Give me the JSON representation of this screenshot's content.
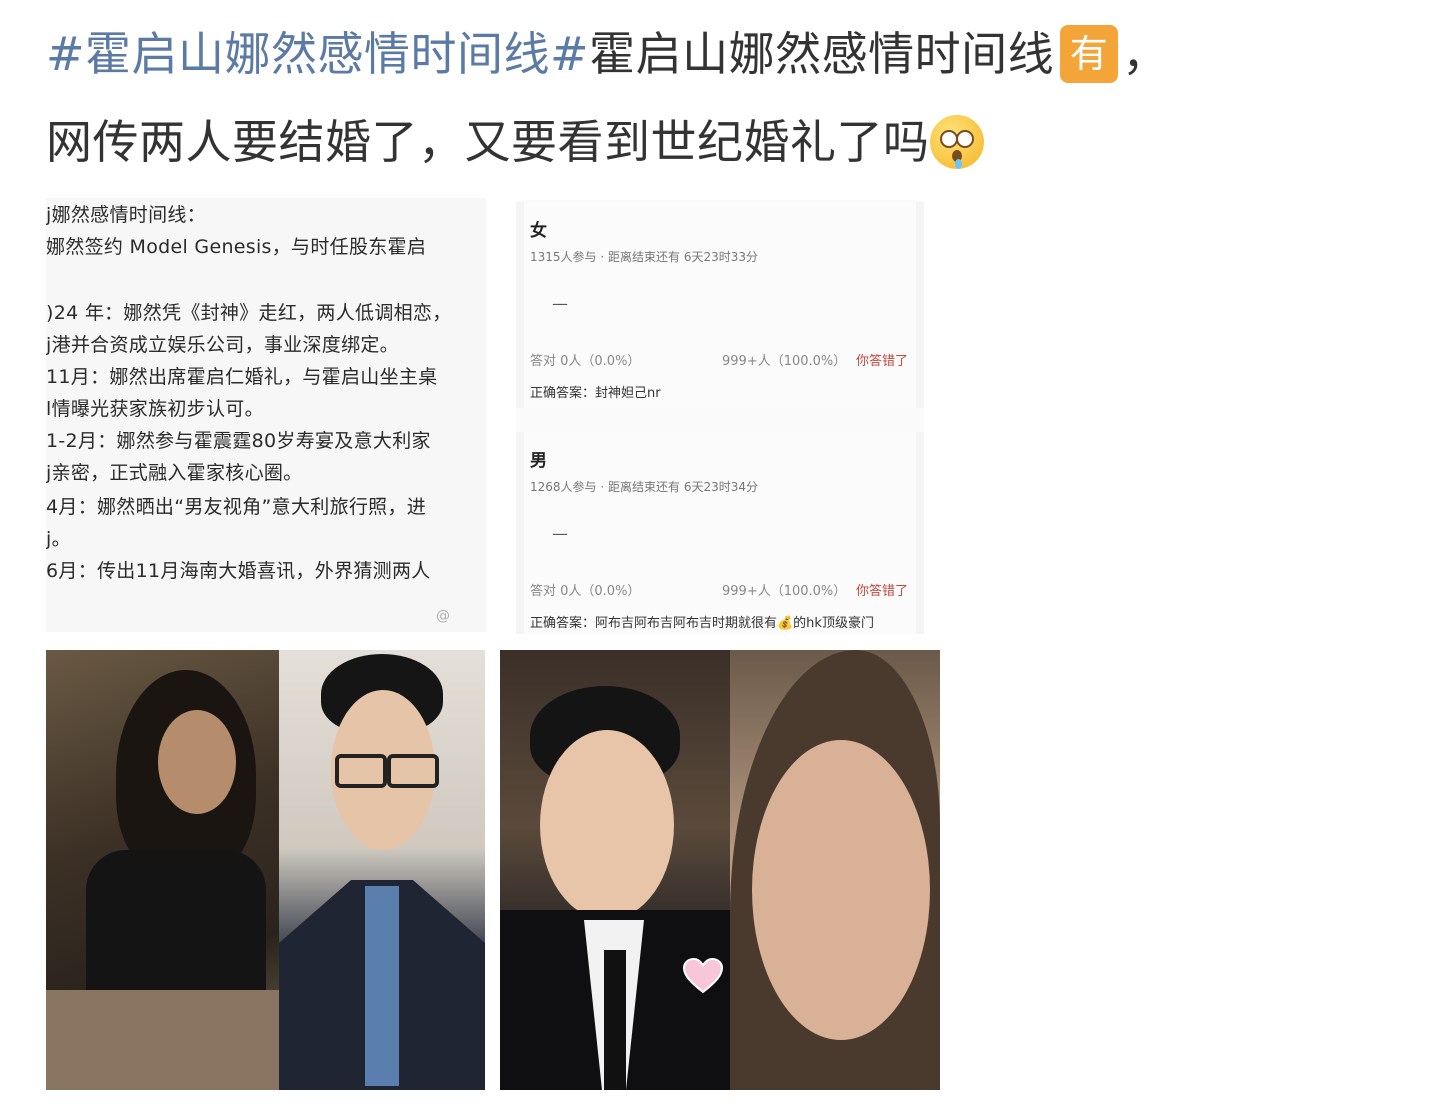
{
  "post": {
    "hashtag": "#霍启山娜然感情时间线#",
    "line1_tail": "霍启山娜然感情时间线",
    "badge": "有",
    "comma": "，",
    "line2": "网传两人要结婚了，又要看到世纪婚礼了吗",
    "emoji": "flushed-tear-emoji"
  },
  "timeline_image": {
    "lines": [
      "j娜然感情时间线：",
      "  娜然签约 Model Genesis，与时任股东霍启",
      "",
      ")24 年：娜然凭《封神》走红，两人低调相恋，",
      "j港并合资成立娱乐公司，事业深度绑定。",
      "11月：娜然出席霍启仁婚礼，与霍启山坐主桌",
      "l情曝光获家族初步认可。",
      "1-2月：娜然参与霍震霆80岁寿宴及意大利家",
      "j亲密，正式融入霍家核心圈。",
      "4月：娜然晒出“男友视角”意大利旅行照，进",
      "j。",
      "6月：传出11月海南大婚喜讯，外界猜测两人"
    ],
    "watermark": "@"
  },
  "polls": [
    {
      "title": "女",
      "participants": "1315人参与",
      "remaining": "距离结束还有 6天23时33分",
      "dash": "—",
      "correct_count": "答对  0人（0.0%）",
      "total": "999+人（100.0%）",
      "wrong_label": "你答错了",
      "correct_answer": "正确答案：封神妲己nr"
    },
    {
      "title": "男",
      "participants": "1268人参与",
      "remaining": "距离结束还有 6天23时34分",
      "dash": "—",
      "correct_count": "答对  0人（0.0%）",
      "total": "999+人（100.0%）",
      "wrong_label": "你答错了",
      "correct_answer": "正确答案：阿布吉阿布吉阿布吉时期就很有💰的hk顶级豪门"
    }
  ],
  "colors": {
    "hashtag": "#5b7aa6",
    "text": "#333333",
    "badge": "#f3a53a",
    "wrong": "#c2483e"
  }
}
